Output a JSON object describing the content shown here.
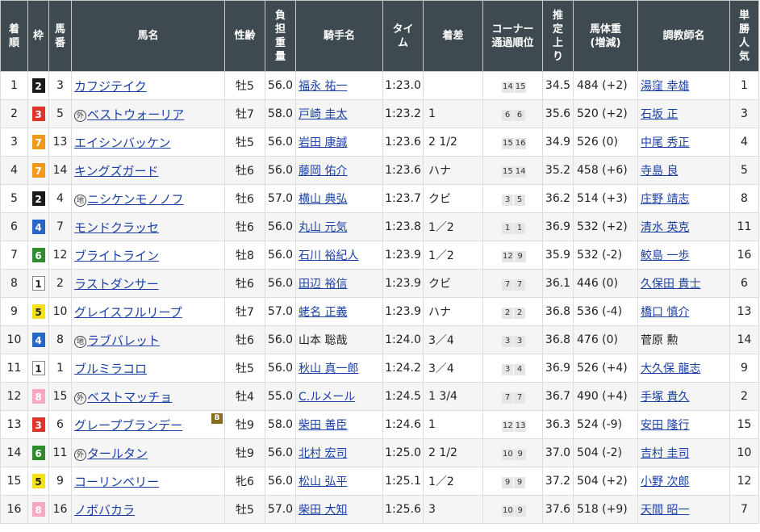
{
  "headers": {
    "rank": "着\n順",
    "waku": "枠",
    "umaban": "馬\n番",
    "horse": "馬名",
    "sex_age": "性齢",
    "burden": "負\n担\n重\n量",
    "jockey": "騎手名",
    "time": "タイ\nム",
    "margin": "着差",
    "corner": "コーナー\n通過順位",
    "last3f": "推\n定\n上\nり",
    "body_weight": "馬体重\n(増減)",
    "trainer": "調教師名",
    "popularity": "単\n勝\n人\n気"
  },
  "waku_colors": {
    "1": {
      "bg": "#ffffff",
      "fg": "#222222",
      "border": "#888888"
    },
    "2": {
      "bg": "#1a1a1a",
      "fg": "#ffffff",
      "border": "#1a1a1a"
    },
    "3": {
      "bg": "#e0332a",
      "fg": "#ffffff",
      "border": "#e0332a"
    },
    "4": {
      "bg": "#2566c8",
      "fg": "#ffffff",
      "border": "#2566c8"
    },
    "5": {
      "bg": "#f5e11a",
      "fg": "#222222",
      "border": "#f5e11a"
    },
    "6": {
      "bg": "#2e8b2e",
      "fg": "#ffffff",
      "border": "#2e8b2e"
    },
    "7": {
      "bg": "#f2991c",
      "fg": "#ffffff",
      "border": "#f2991c"
    },
    "8": {
      "bg": "#f7a8c0",
      "fg": "#ffffff",
      "border": "#f7a8c0"
    }
  },
  "rows": [
    {
      "rank": "1",
      "waku": "2",
      "umaban": "3",
      "mark": "",
      "horse": "カフジテイク",
      "blinker": "",
      "sex_age": "牡5",
      "burden": "56.0",
      "jockey": "福永 祐一",
      "jockey_link": true,
      "time": "1:23.0",
      "margin": "",
      "corners": [
        "14",
        "15"
      ],
      "last3f": "34.5",
      "body_weight": "484 (+2)",
      "trainer": "湯窪 幸雄",
      "trainer_link": true,
      "popularity": "1"
    },
    {
      "rank": "2",
      "waku": "3",
      "umaban": "5",
      "mark": "外",
      "horse": "ベストウォーリア",
      "blinker": "",
      "sex_age": "牡7",
      "burden": "58.0",
      "jockey": "戸崎 圭太",
      "jockey_link": true,
      "time": "1:23.2",
      "margin": "1",
      "corners": [
        "6",
        "6"
      ],
      "last3f": "35.6",
      "body_weight": "520 (+2)",
      "trainer": "石坂 正",
      "trainer_link": true,
      "popularity": "3"
    },
    {
      "rank": "3",
      "waku": "7",
      "umaban": "13",
      "mark": "",
      "horse": "エイシンバッケン",
      "blinker": "",
      "sex_age": "牡5",
      "burden": "56.0",
      "jockey": "岩田 康誠",
      "jockey_link": true,
      "time": "1:23.6",
      "margin": "2 1/2",
      "corners": [
        "15",
        "16"
      ],
      "last3f": "34.9",
      "body_weight": "526 (0)",
      "trainer": "中尾 秀正",
      "trainer_link": true,
      "popularity": "4"
    },
    {
      "rank": "4",
      "waku": "7",
      "umaban": "14",
      "mark": "",
      "horse": "キングズガード",
      "blinker": "",
      "sex_age": "牡6",
      "burden": "56.0",
      "jockey": "藤岡 佑介",
      "jockey_link": true,
      "time": "1:23.6",
      "margin": "ハナ",
      "corners": [
        "15",
        "14"
      ],
      "last3f": "35.2",
      "body_weight": "458 (+6)",
      "trainer": "寺島 良",
      "trainer_link": true,
      "popularity": "5"
    },
    {
      "rank": "5",
      "waku": "2",
      "umaban": "4",
      "mark": "地",
      "horse": "ニシケンモノノフ",
      "blinker": "",
      "sex_age": "牡6",
      "burden": "57.0",
      "jockey": "横山 典弘",
      "jockey_link": true,
      "time": "1:23.7",
      "margin": "クビ",
      "corners": [
        "3",
        "5"
      ],
      "last3f": "36.2",
      "body_weight": "514 (+3)",
      "trainer": "庄野 靖志",
      "trainer_link": true,
      "popularity": "8"
    },
    {
      "rank": "6",
      "waku": "4",
      "umaban": "7",
      "mark": "",
      "horse": "モンドクラッセ",
      "blinker": "",
      "sex_age": "牡6",
      "burden": "56.0",
      "jockey": "丸山 元気",
      "jockey_link": true,
      "time": "1:23.8",
      "margin": "1／2",
      "corners": [
        "1",
        "1"
      ],
      "last3f": "36.9",
      "body_weight": "532 (+2)",
      "trainer": "清水 英克",
      "trainer_link": true,
      "popularity": "11"
    },
    {
      "rank": "7",
      "waku": "6",
      "umaban": "12",
      "mark": "",
      "horse": "ブライトライン",
      "blinker": "",
      "sex_age": "牡8",
      "burden": "56.0",
      "jockey": "石川 裕紀人",
      "jockey_link": true,
      "time": "1:23.9",
      "margin": "1／2",
      "corners": [
        "12",
        "9"
      ],
      "last3f": "35.9",
      "body_weight": "532 (-2)",
      "trainer": "鮫島 一歩",
      "trainer_link": true,
      "popularity": "16"
    },
    {
      "rank": "8",
      "waku": "1",
      "umaban": "2",
      "mark": "",
      "horse": "ラストダンサー",
      "blinker": "",
      "sex_age": "牡6",
      "burden": "56.0",
      "jockey": "田辺 裕信",
      "jockey_link": true,
      "time": "1:23.9",
      "margin": "クビ",
      "corners": [
        "7",
        "7"
      ],
      "last3f": "36.1",
      "body_weight": "446 (0)",
      "trainer": "久保田 貴士",
      "trainer_link": true,
      "popularity": "6"
    },
    {
      "rank": "9",
      "waku": "5",
      "umaban": "10",
      "mark": "",
      "horse": "グレイスフルリープ",
      "blinker": "",
      "sex_age": "牡7",
      "burden": "57.0",
      "jockey": "蛯名 正義",
      "jockey_link": true,
      "time": "1:23.9",
      "margin": "ハナ",
      "corners": [
        "2",
        "2"
      ],
      "last3f": "36.8",
      "body_weight": "536 (-4)",
      "trainer": "橋口 慎介",
      "trainer_link": true,
      "popularity": "13"
    },
    {
      "rank": "10",
      "waku": "4",
      "umaban": "8",
      "mark": "地",
      "horse": "ラブバレット",
      "blinker": "",
      "sex_age": "牡6",
      "burden": "56.0",
      "jockey": "山本 聡哉",
      "jockey_link": false,
      "time": "1:24.0",
      "margin": "3／4",
      "corners": [
        "3",
        "3"
      ],
      "last3f": "36.8",
      "body_weight": "476 (0)",
      "trainer": "菅原 勲",
      "trainer_link": false,
      "popularity": "14"
    },
    {
      "rank": "11",
      "waku": "1",
      "umaban": "1",
      "mark": "",
      "horse": "ブルミラコロ",
      "blinker": "",
      "sex_age": "牡5",
      "burden": "56.0",
      "jockey": "秋山 真一郎",
      "jockey_link": true,
      "time": "1:24.2",
      "margin": "3／4",
      "corners": [
        "3",
        "4"
      ],
      "last3f": "36.9",
      "body_weight": "526 (+4)",
      "trainer": "大久保 龍志",
      "trainer_link": true,
      "popularity": "9"
    },
    {
      "rank": "12",
      "waku": "8",
      "umaban": "15",
      "mark": "外",
      "horse": "ベストマッチョ",
      "blinker": "",
      "sex_age": "牡4",
      "burden": "55.0",
      "jockey": "C.ルメール",
      "jockey_link": true,
      "time": "1:24.5",
      "margin": "1 3/4",
      "corners": [
        "7",
        "7"
      ],
      "last3f": "36.7",
      "body_weight": "490 (+4)",
      "trainer": "手塚 貴久",
      "trainer_link": true,
      "popularity": "2"
    },
    {
      "rank": "13",
      "waku": "3",
      "umaban": "6",
      "mark": "",
      "horse": "グレープブランデー",
      "blinker": "B",
      "sex_age": "牡9",
      "burden": "58.0",
      "jockey": "柴田 善臣",
      "jockey_link": true,
      "time": "1:24.6",
      "margin": "1",
      "corners": [
        "12",
        "13"
      ],
      "last3f": "36.3",
      "body_weight": "524 (-9)",
      "trainer": "安田 隆行",
      "trainer_link": true,
      "popularity": "15"
    },
    {
      "rank": "14",
      "waku": "6",
      "umaban": "11",
      "mark": "外",
      "horse": "タールタン",
      "blinker": "",
      "sex_age": "牡9",
      "burden": "56.0",
      "jockey": "北村 宏司",
      "jockey_link": true,
      "time": "1:25.0",
      "margin": "2 1/2",
      "corners": [
        "10",
        "9"
      ],
      "last3f": "37.0",
      "body_weight": "504 (-2)",
      "trainer": "吉村 圭司",
      "trainer_link": true,
      "popularity": "10"
    },
    {
      "rank": "15",
      "waku": "5",
      "umaban": "9",
      "mark": "",
      "horse": "コーリンベリー",
      "blinker": "",
      "sex_age": "牝6",
      "burden": "56.0",
      "jockey": "松山 弘平",
      "jockey_link": true,
      "time": "1:25.1",
      "margin": "1／2",
      "corners": [
        "9",
        "9"
      ],
      "last3f": "37.2",
      "body_weight": "504 (+2)",
      "trainer": "小野 次郎",
      "trainer_link": true,
      "popularity": "12"
    },
    {
      "rank": "16",
      "waku": "8",
      "umaban": "16",
      "mark": "",
      "horse": "ノボバカラ",
      "blinker": "",
      "sex_age": "牡5",
      "burden": "57.0",
      "jockey": "柴田 大知",
      "jockey_link": true,
      "time": "1:25.6",
      "margin": "3",
      "corners": [
        "10",
        "9"
      ],
      "last3f": "37.6",
      "body_weight": "518 (+9)",
      "trainer": "天間 昭一",
      "trainer_link": true,
      "popularity": "7"
    }
  ]
}
